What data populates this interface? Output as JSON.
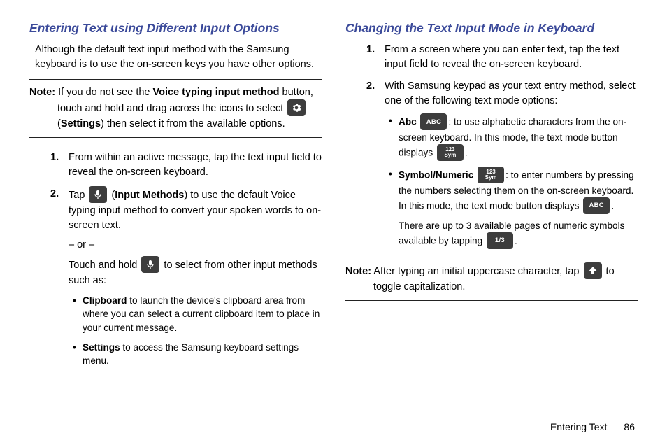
{
  "left": {
    "title": "Entering Text using Different Input Options",
    "intro": "Although the default text input method with the Samsung keyboard is to use the on-screen keys you have other options.",
    "noteLabel": "Note:",
    "noteText1": "If you do not see the ",
    "noteBold": "Voice typing input method",
    "noteText2": " button, touch and hold and drag across the icons to select ",
    "noteText3": " (",
    "noteBold2": "Settings",
    "noteText4": ") then select it from the available options.",
    "step1": "From within an active message, tap the text input field to reveal the on-screen keyboard.",
    "step2a": "Tap ",
    "step2b": " (",
    "step2bold": "Input Methods",
    "step2c": ") to use the default Voice typing input method to convert your spoken words to on-screen text.",
    "or": "– or –",
    "step2d1": "Touch and hold ",
    "step2d2": " to select from other input methods such as:",
    "bullet1bold": "Clipboard",
    "bullet1": " to launch the device's clipboard area from where you can select a current clipboard item to place in your current message.",
    "bullet2bold": "Settings",
    "bullet2": " to access the Samsung keyboard settings menu."
  },
  "right": {
    "title": "Changing the Text Input Mode in Keyboard",
    "step1": "From a screen where you can enter text, tap the text input field to reveal the on-screen keyboard.",
    "step2": "With Samsung keypad as your text entry method, select one of the following text mode options:",
    "b1bold": "Abc",
    "b1a": ": to use alphabetic characters from the on-screen keyboard. In this mode, the text mode button displays ",
    "b1b": ".",
    "b2bold": "Symbol/Numeric",
    "b2a": ": to enter numbers by pressing the numbers selecting them on the on-screen keyboard. In this mode, the text mode button displays ",
    "b2b": ".",
    "b2c": "There are up to 3 available pages of numeric symbols available by tapping ",
    "b2d": ".",
    "noteLabel": "Note:",
    "noteText1": "After typing an initial uppercase character, tap ",
    "noteText2": " to toggle capitalization."
  },
  "icons": {
    "abc": "ABC",
    "sym1": "123",
    "sym2": "Sym",
    "page": "1/3"
  },
  "footer": {
    "section": "Entering Text",
    "page": "86"
  }
}
